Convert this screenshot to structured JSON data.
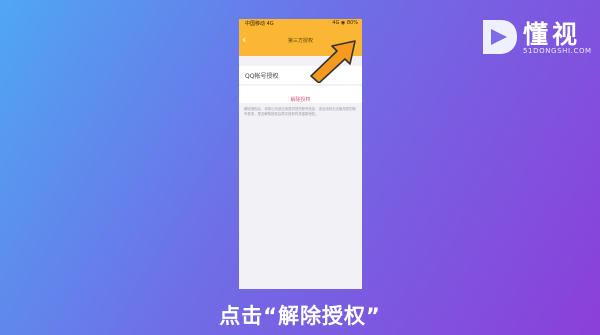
{
  "brand": {
    "title": "懂视",
    "subtitle": "51DONGSHI.COM"
  },
  "phone": {
    "status": {
      "left": "中国移动 4G",
      "right": "4G ◉ 80%"
    },
    "nav": {
      "title": "第三方授权",
      "back_icon": "back-chevron-icon"
    },
    "qq_label": "QQ帐号授权",
    "revoke_label": "解除授权",
    "note": "解除授权后，将停止向该应用提供您的账号信息，该应用将无法使用您的账号登录，是否解除授权后再次授权时请重新授权。"
  },
  "caption": "点击“解除授权”",
  "colors": {
    "accent": "#fbb634",
    "arrow": "#f59a1d",
    "revoke_text": "#e0567a"
  }
}
